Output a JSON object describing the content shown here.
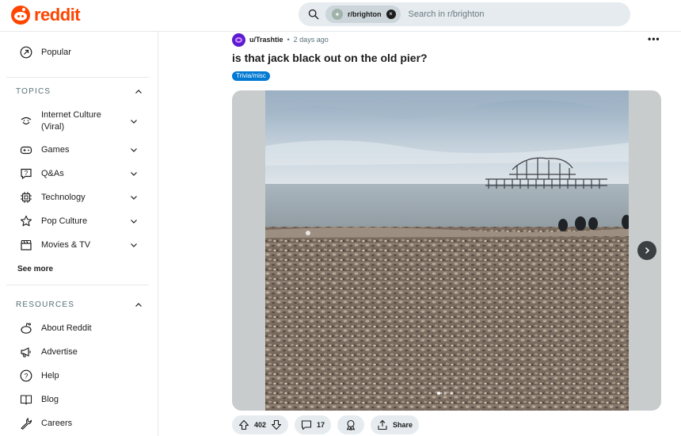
{
  "header": {
    "logo_text": "reddit",
    "search": {
      "chip_label": "r/brighton",
      "placeholder": "Search in r/brighton"
    }
  },
  "sidebar": {
    "popular_label": "Popular",
    "topics": {
      "heading": "TOPICS",
      "items": [
        {
          "label": "Internet Culture\n(Viral)",
          "icon": "smile-icon"
        },
        {
          "label": "Games",
          "icon": "gamepad-icon"
        },
        {
          "label": "Q&As",
          "icon": "question-bubble-icon"
        },
        {
          "label": "Technology",
          "icon": "chip-icon"
        },
        {
          "label": "Pop Culture",
          "icon": "star-icon"
        },
        {
          "label": "Movies & TV",
          "icon": "clapperboard-icon"
        }
      ],
      "see_more": "See more"
    },
    "resources": {
      "heading": "RESOURCES",
      "items": [
        {
          "label": "About Reddit",
          "icon": "reddit-icon"
        },
        {
          "label": "Advertise",
          "icon": "megaphone-icon"
        },
        {
          "label": "Help",
          "icon": "help-icon"
        },
        {
          "label": "Blog",
          "icon": "book-icon"
        },
        {
          "label": "Careers",
          "icon": "wrench-icon"
        }
      ]
    }
  },
  "post": {
    "author": "u/Trashtie",
    "separator": "•",
    "timestamp": "2 days ago",
    "more": "•••",
    "title": "is that jack black out on the old pier?",
    "flair": "Trivia/misc",
    "flair_color": "#0079d3",
    "gallery": {
      "total_dots": 3,
      "active_index": 0
    },
    "actions": {
      "score": "402",
      "comments": "17",
      "share_label": "Share"
    }
  },
  "colors": {
    "brand": "#ff4500",
    "pill_bg": "#e5ebee"
  }
}
